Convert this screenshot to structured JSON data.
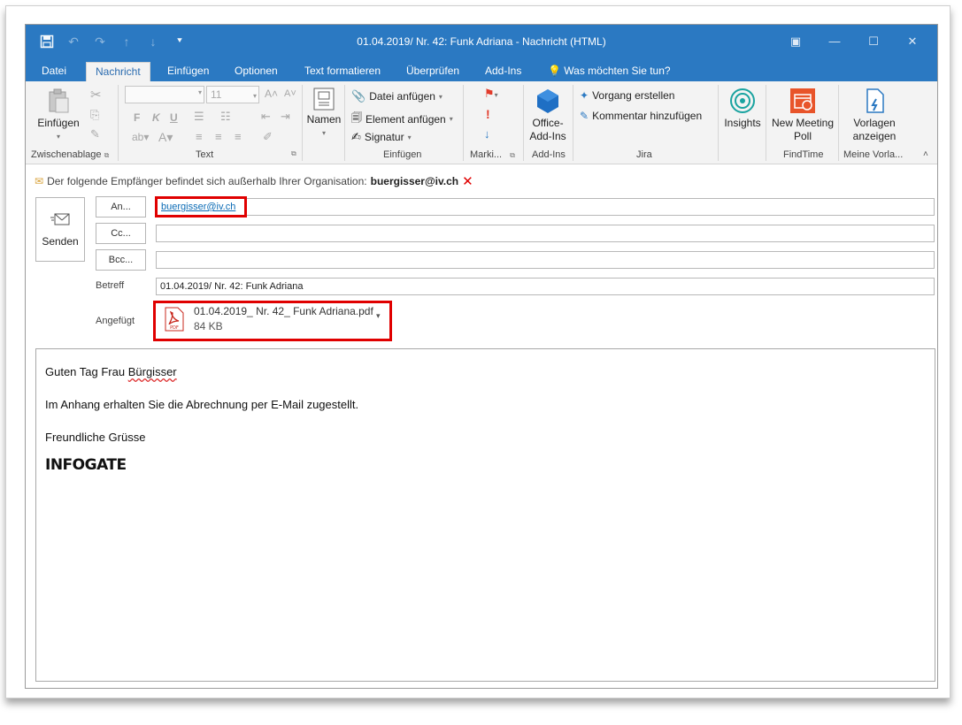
{
  "window": {
    "title": "01.04.2019/ Nr. 42:  Funk Adriana  -  Nachricht (HTML)"
  },
  "tabs": [
    "Datei",
    "Nachricht",
    "Einfügen",
    "Optionen",
    "Text formatieren",
    "Überprüfen",
    "Add-Ins"
  ],
  "tell_me": "Was möchten Sie tun?",
  "ribbon": {
    "clipboard": {
      "paste": "Einfügen",
      "label": "Zwischenablage"
    },
    "text": {
      "font_size": "11",
      "bold": "F",
      "italic": "K",
      "underline": "U",
      "label": "Text"
    },
    "names": {
      "button": "Namen"
    },
    "include": {
      "attach_file": "Datei anfügen",
      "attach_item": "Element anfügen",
      "signature": "Signatur",
      "label": "Einfügen"
    },
    "tags": {
      "label": "Marki..."
    },
    "addins": {
      "office": "Office-Add-Ins",
      "label": "Add-Ins"
    },
    "jira": {
      "create": "Vorgang erstellen",
      "comment": "Kommentar hinzufügen",
      "label": "Jira"
    },
    "insights": {
      "button": "Insights"
    },
    "findtime": {
      "button": "New Meeting Poll",
      "label": "FindTime"
    },
    "templates": {
      "button": "Vorlagen anzeigen",
      "label": "Meine Vorla..."
    }
  },
  "notice": {
    "text": "Der folgende Empfänger befindet sich außerhalb Ihrer Organisation:",
    "recipient": "buergisser@iv.ch"
  },
  "compose": {
    "send": "Senden",
    "to_button": "An...",
    "cc_button": "Cc...",
    "bcc_button": "Bcc...",
    "to_value": "buergisser@iv.ch",
    "subject_label": "Betreff",
    "subject_value": "01.04.2019/ Nr. 42:  Funk Adriana",
    "attached_label": "Angefügt",
    "attachment_name": "01.04.2019_ Nr. 42_  Funk Adriana.pdf",
    "attachment_size": "84 KB",
    "attachment_type": "PDF"
  },
  "message": {
    "greeting_pre": "Guten Tag Frau ",
    "greeting_name": "Bürgisser",
    "line1": "Im Anhang erhalten Sie die Abrechnung per E-Mail zugestellt.",
    "closing": "Freundliche Grüsse",
    "logo": "INFOGATE"
  },
  "colors": {
    "titlebar": "#2b79c2",
    "highlight": "#e00000",
    "findtime": "#e8542a"
  }
}
